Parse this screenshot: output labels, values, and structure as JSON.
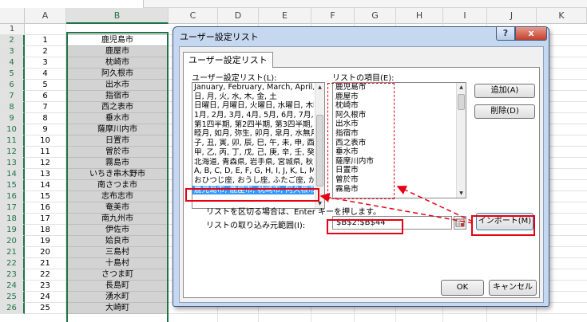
{
  "sheet": {
    "columns": [
      "A",
      "B",
      "C",
      "D",
      "E",
      "F",
      "G",
      "H",
      "I",
      "J",
      "K"
    ],
    "selected_column": "B",
    "rows": [
      {
        "row": "1",
        "a": "",
        "b": ""
      },
      {
        "row": "2",
        "a": "1",
        "b": "鹿児島市"
      },
      {
        "row": "3",
        "a": "2",
        "b": "鹿屋市"
      },
      {
        "row": "4",
        "a": "3",
        "b": "枕崎市"
      },
      {
        "row": "5",
        "a": "4",
        "b": "阿久根市"
      },
      {
        "row": "6",
        "a": "5",
        "b": "出水市"
      },
      {
        "row": "7",
        "a": "6",
        "b": "指宿市"
      },
      {
        "row": "8",
        "a": "7",
        "b": "西之表市"
      },
      {
        "row": "9",
        "a": "8",
        "b": "垂水市"
      },
      {
        "row": "10",
        "a": "9",
        "b": "薩摩川内市"
      },
      {
        "row": "11",
        "a": "10",
        "b": "日置市"
      },
      {
        "row": "12",
        "a": "11",
        "b": "曽於市"
      },
      {
        "row": "13",
        "a": "12",
        "b": "霧島市"
      },
      {
        "row": "14",
        "a": "13",
        "b": "いちき串木野市"
      },
      {
        "row": "15",
        "a": "14",
        "b": "南さつま市"
      },
      {
        "row": "16",
        "a": "15",
        "b": "志布志市"
      },
      {
        "row": "17",
        "a": "16",
        "b": "奄美市"
      },
      {
        "row": "18",
        "a": "17",
        "b": "南九州市"
      },
      {
        "row": "19",
        "a": "18",
        "b": "伊佐市"
      },
      {
        "row": "20",
        "a": "19",
        "b": "姶良市"
      },
      {
        "row": "21",
        "a": "20",
        "b": "三島村"
      },
      {
        "row": "22",
        "a": "21",
        "b": "十島村"
      },
      {
        "row": "23",
        "a": "22",
        "b": "さつま町"
      },
      {
        "row": "24",
        "a": "23",
        "b": "長島町"
      },
      {
        "row": "25",
        "a": "24",
        "b": "湧水町"
      },
      {
        "row": "26",
        "a": "25",
        "b": "大崎町"
      }
    ]
  },
  "dialog": {
    "title": "ユーザー設定リスト",
    "help_label": "?",
    "close_label": "x",
    "tab_label": "ユーザー設定リスト",
    "custom_lists_label": "ユーザー設定リスト(L):",
    "list_entries_label": "リストの項目(E):",
    "custom_lists": [
      "January, February, March, April, M",
      "日, 月, 火, 水, 木, 金, 土",
      "日曜日, 月曜日, 火曜日, 水曜日, 木曜日",
      "1月, 2月, 3月, 4月, 5月, 6月, 7月, 8",
      "第1四半期, 第2四半期, 第3四半期, 第",
      "睦月, 如月, 弥生, 卯月, 皐月, 水無月",
      "子, 丑, 寅, 卯, 辰, 巳, 午, 未, 申, 酉",
      "甲, 乙, 丙, 丁, 戊, 己, 庚, 辛, 壬, 癸",
      "北海道, 青森県, 岩手県, 宮城県, 秋田",
      "A, B, C, D, E, F, G, H, I, J, K, L, M",
      "おひつじ座, おうし座, ふたご座, かに座,",
      "鹿児島市, 鹿屋市, 枕崎市, 阿久根市"
    ],
    "selected_list_index": 11,
    "list_entries": [
      "鹿児島市",
      "鹿屋市",
      "枕崎市",
      "阿久根市",
      "出水市",
      "指宿市",
      "西之表市",
      "垂水市",
      "薩摩川内市",
      "日置市",
      "曽於市",
      "霧島市"
    ],
    "add_button": "追加(A)",
    "delete_button": "削除(D)",
    "hint_text": "リストを区切る場合は、Enter キーを押します。",
    "import_range_label": "リストの取り込み元範囲(I):",
    "import_range_value": "$B$2:$B$44",
    "import_button": "インポート(M)",
    "ok_button": "OK",
    "cancel_button": "キャンセル"
  },
  "colors": {
    "highlight": "#e60012",
    "selection": "#3399ff",
    "excel_green": "#217346"
  }
}
